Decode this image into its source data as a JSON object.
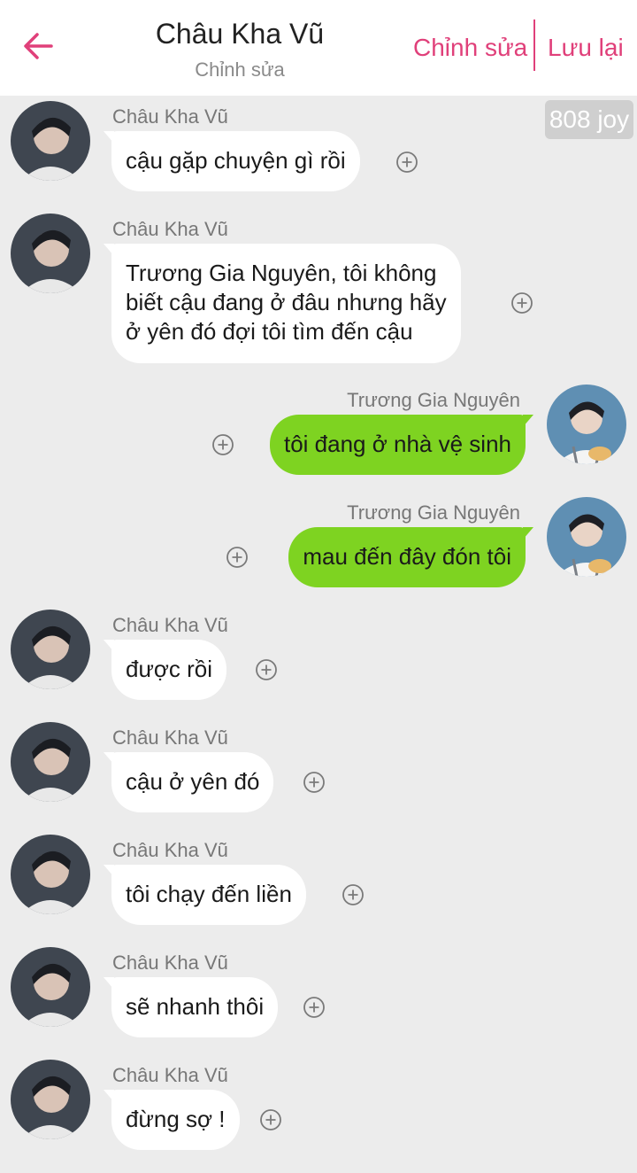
{
  "header": {
    "title": "Châu Kha Vũ",
    "subtitle": "Chỉnh sửa",
    "edit_label": "Chỉnh sửa",
    "save_label": "Lưu lại",
    "back_icon": "arrow-left-icon",
    "accent_color": "#e0407a"
  },
  "watermark": "808 joy",
  "colors": {
    "background": "#ececec",
    "incoming_bubble": "#ffffff",
    "outgoing_bubble": "#7ed321"
  },
  "messages": [
    {
      "side": "left",
      "sender": "Châu Kha Vũ",
      "lines": [
        "cậu gặp chuyện gì rồi"
      ]
    },
    {
      "side": "left",
      "sender": "Châu Kha Vũ",
      "lines": [
        "Trương Gia Nguyên, tôi không",
        "biết cậu đang ở đâu nhưng hãy",
        "ở yên đó đợi tôi tìm đến cậu"
      ]
    },
    {
      "side": "right",
      "sender": "Trương Gia Nguyên",
      "lines": [
        "tôi đang ở nhà vệ sinh"
      ]
    },
    {
      "side": "right",
      "sender": "Trương Gia Nguyên",
      "lines": [
        "mau đến đây đón tôi"
      ]
    },
    {
      "side": "left",
      "sender": "Châu Kha Vũ",
      "lines": [
        "được rồi"
      ]
    },
    {
      "side": "left",
      "sender": "Châu Kha Vũ",
      "lines": [
        "cậu ở yên đó"
      ]
    },
    {
      "side": "left",
      "sender": "Châu Kha Vũ",
      "lines": [
        "tôi chạy đến liền"
      ]
    },
    {
      "side": "left",
      "sender": "Châu Kha Vũ",
      "lines": [
        "sẽ nhanh thôi"
      ]
    },
    {
      "side": "left",
      "sender": "Châu Kha Vũ",
      "lines": [
        "đừng sợ !"
      ]
    }
  ]
}
